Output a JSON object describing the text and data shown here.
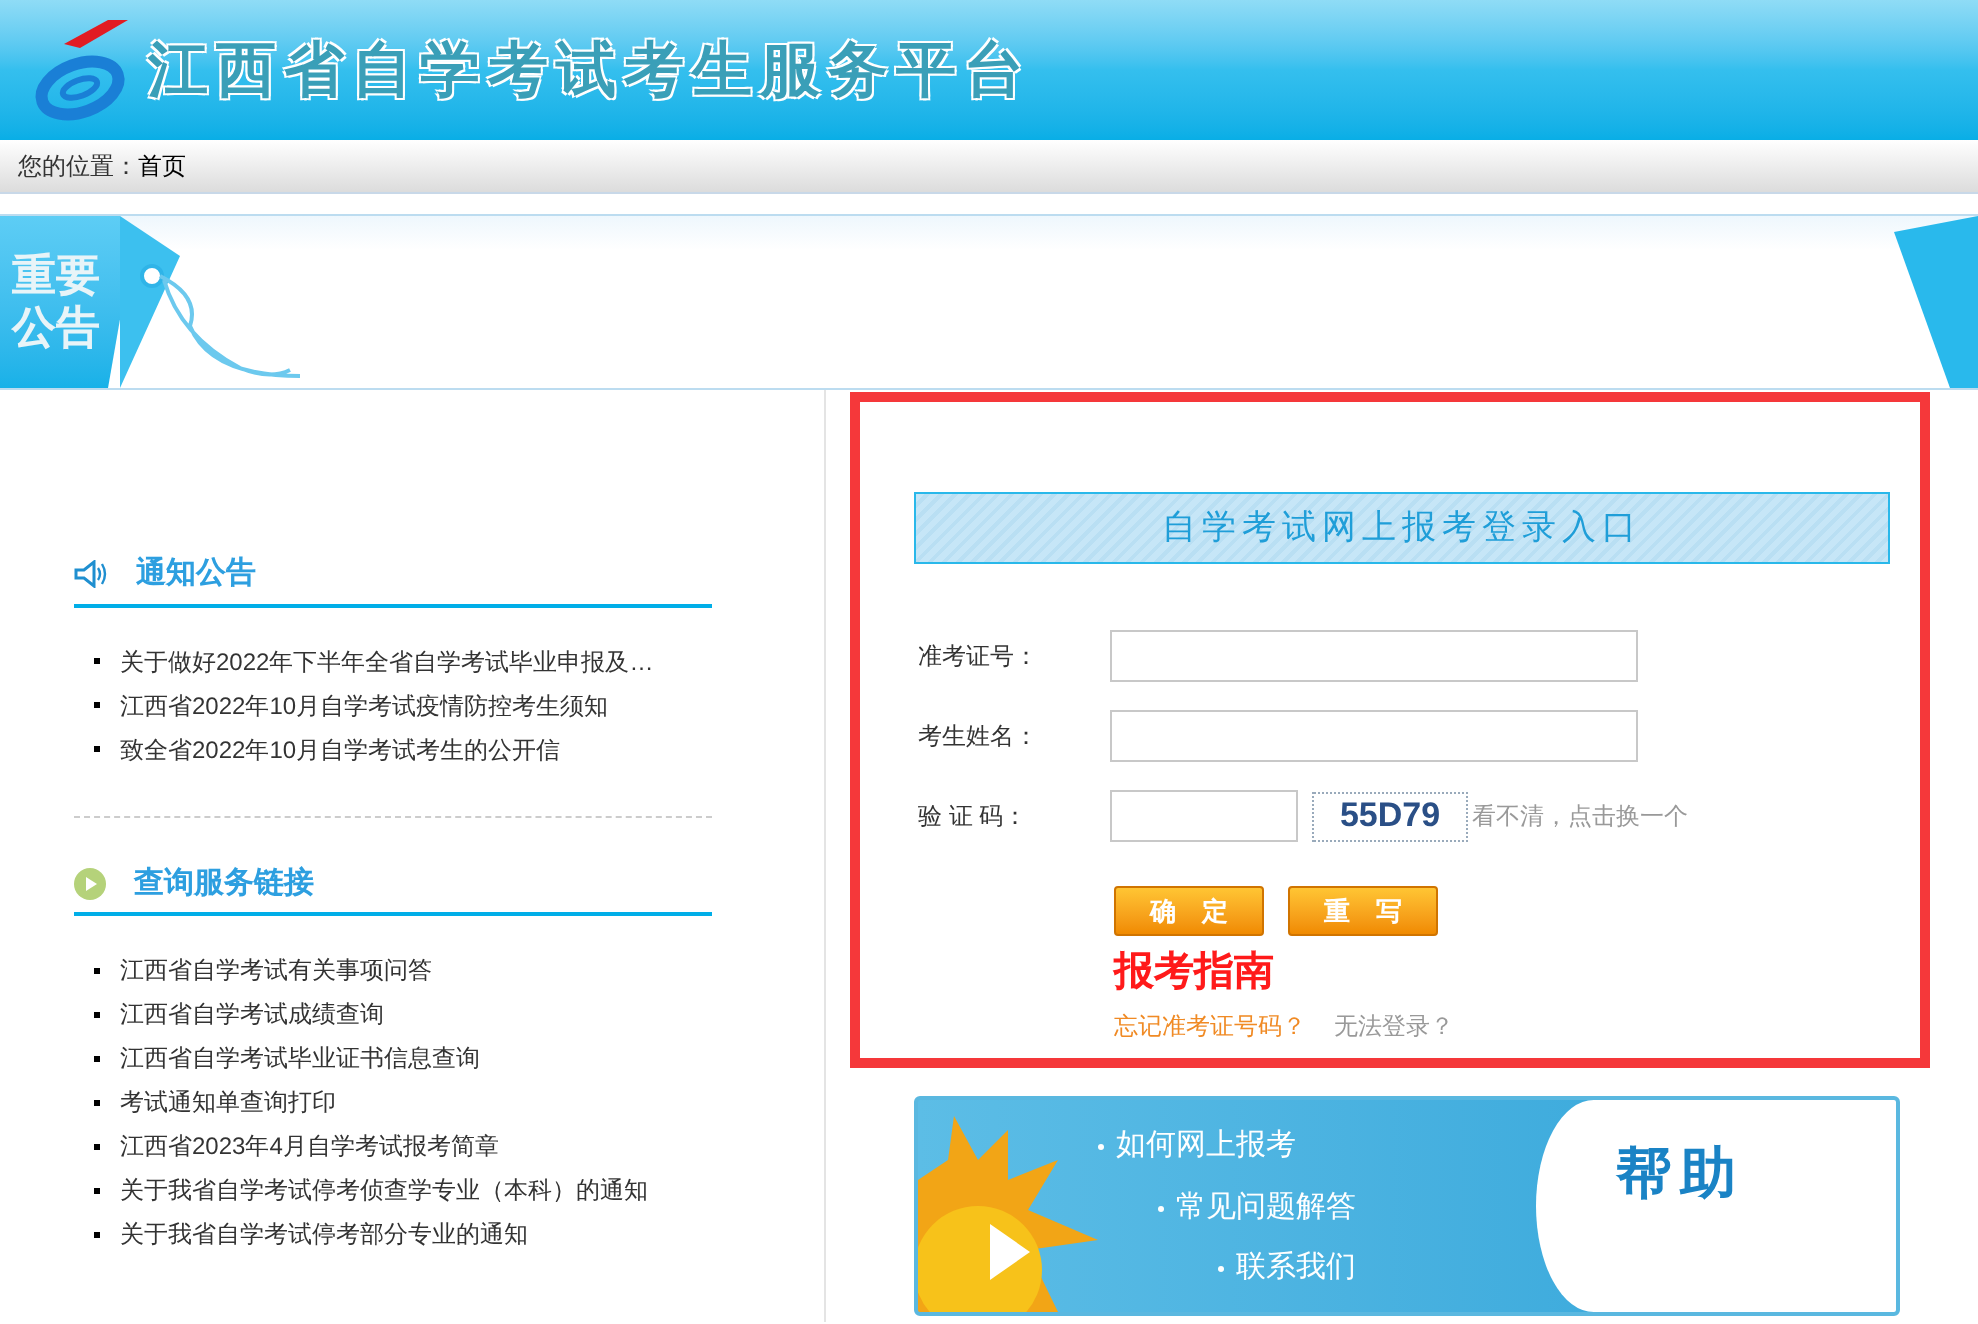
{
  "header": {
    "title": "江西省自学考试考生服务平台"
  },
  "breadcrumb": {
    "label": "您的位置：",
    "current": "首页"
  },
  "notice_banner": {
    "tag": "重要公告"
  },
  "sections": [
    {
      "kind": "notice",
      "title": "通知公告",
      "items": [
        "关于做好2022年下半年全省自学考试毕业申报及…",
        "江西省2022年10月自学考试疫情防控考生须知",
        "致全省2022年10月自学考试考生的公开信"
      ]
    },
    {
      "kind": "links",
      "title": "查询服务链接",
      "items": [
        "江西省自学考试有关事项问答",
        "江西省自学考试成绩查询",
        "江西省自学考试毕业证书信息查询",
        "考试通知单查询打印",
        "江西省2023年4月自学考试报考简章",
        "关于我省自学考试停考侦查学专业（本科）的通知",
        "关于我省自学考试停考部分专业的通知"
      ]
    }
  ],
  "login": {
    "highlighted": true,
    "title": "自学考试网上报考登录入口",
    "fields": [
      {
        "kind": "text",
        "label": "准考证号："
      },
      {
        "kind": "text",
        "label": "考生姓名："
      },
      {
        "kind": "captcha",
        "label": "验 证 码：",
        "captcha": "55D79",
        "hint": "看不清，点击换一个"
      }
    ],
    "buttons": [
      "确定",
      "重写"
    ],
    "guide": "报考指南",
    "links": [
      {
        "text": "忘记准考证号码？",
        "color": "#f08a24"
      },
      {
        "text": "无法登录？",
        "color": "#999999"
      }
    ]
  },
  "help_banner": {
    "items": [
      "如何网上报考",
      "常见问题解答",
      "联系我们"
    ],
    "title": "帮助"
  }
}
